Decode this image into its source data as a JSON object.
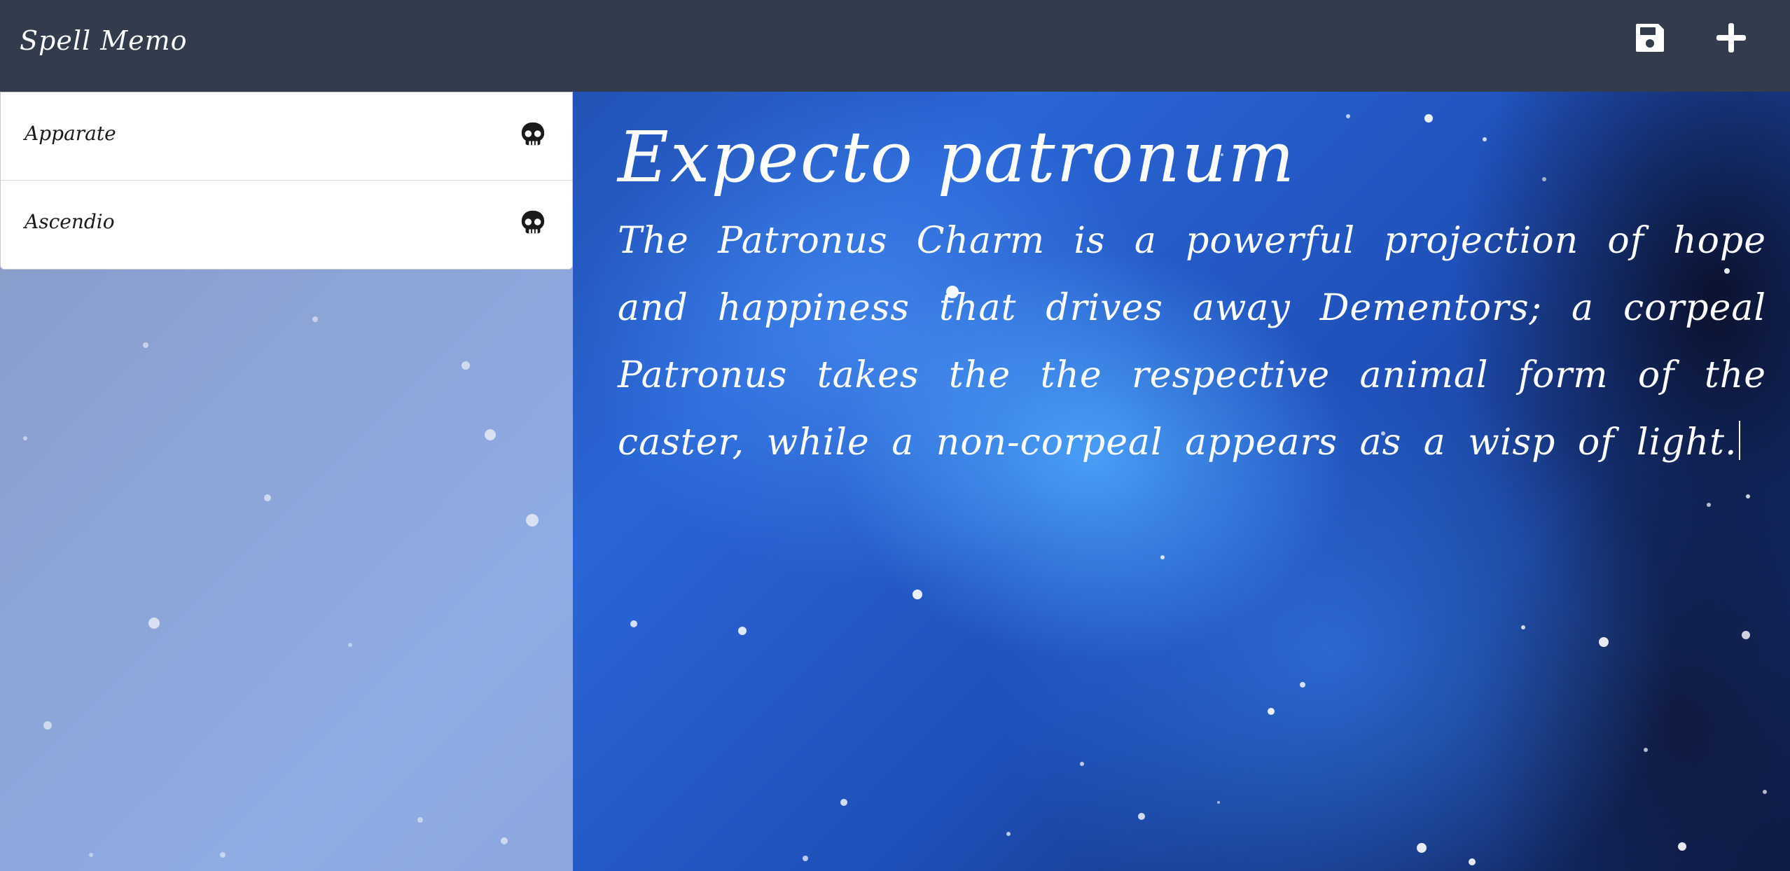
{
  "navbar": {
    "brand": "Spell Memo",
    "save_icon": "save-icon",
    "add_icon": "plus-icon"
  },
  "sidebar": {
    "items": [
      {
        "label": "Apparate",
        "icon": "skull-icon"
      },
      {
        "label": "Ascendio",
        "icon": "skull-icon"
      }
    ]
  },
  "editor": {
    "title": "Expecto patronum",
    "body": "The Patronus Charm is a powerful projection of hope and happiness that drives away Dementors; a corpeal Patronus takes the the respective animal form of the caster, while a non-corpeal appears as a wisp of light."
  },
  "colors": {
    "navbar_bg": "#323c4c",
    "list_bg": "#ffffff",
    "text_light": "#ffffff",
    "text_dark": "#1a1a1a"
  }
}
